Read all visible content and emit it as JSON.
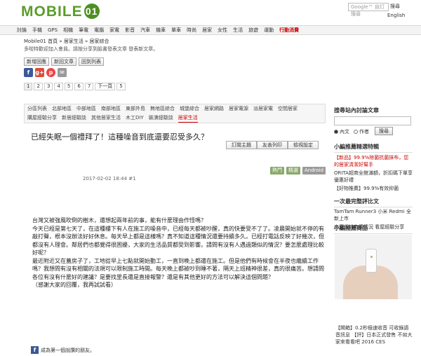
{
  "header": {
    "logo_text": "MOBILE",
    "logo_badge": "01",
    "search_placeholder": "Google™ 自訂搜尋",
    "search_button": "搜尋",
    "lang_link": "English"
  },
  "nav": {
    "items": [
      "討論",
      "手機",
      "GPS",
      "相機",
      "筆電",
      "電腦",
      "家電",
      "影音",
      "汽車",
      "機車",
      "單車",
      "時尚",
      "居家",
      "女性",
      "生活",
      "旅遊",
      "運動",
      "行動消費"
    ],
    "hot_index": 17
  },
  "breadcrumb": {
    "path": "Mobile01 首頁 » 居家生活 » 居家綜合"
  },
  "announcement": "多啦特歡迎加入會員。請按分享到臉書發表文章 發表新文章。",
  "buttons": {
    "new_topic": "新增回應",
    "new_reply": "新回文章",
    "back_list": "回到列表"
  },
  "social_icons": [
    "facebook-icon",
    "google-plus-icon",
    "plurk-icon",
    "mail-icon"
  ],
  "pager": {
    "pages": [
      "1",
      "2",
      "3",
      "4",
      "5",
      "6",
      "7"
    ],
    "current": "1",
    "next": "下一頁",
    "last": "5"
  },
  "forum_tabs": {
    "row1": [
      "分區列表",
      "北部地區",
      "中部地區",
      "南部地區",
      "東部外島",
      "無地區綜合",
      "城堡綜合",
      "居家網路",
      "居家電源",
      "派居家電",
      "空間居家"
    ],
    "row2": [
      "購屋經驗分享",
      "新居經驗談",
      "其他居家生活",
      "木工DIY",
      "裝潢經驗談",
      "居家生活"
    ],
    "selected": "居家生活"
  },
  "post": {
    "title": "已經失眠一個禮拜了！這種噪音到底還要忍受多久？",
    "actions": [
      "訂閱主題",
      "友善列印",
      "檢視設定"
    ],
    "tags": [
      "熱門",
      "精選",
      "Android"
    ],
    "meta": "2017-02-02 18:44  #1",
    "paragraphs": [
      "台灣又被強風吹倒的樹木，還想起兩年前的事，能有什麼理由作怪嗎？",
      "今天已經是第七天了，在這種樓下有人在施工的噪音中，已經每天都被吵醒，真的快要受不了了。凌晨開始就不停的有敲打聲，根本沒辦法好好休息。每天早上都是這樣嗎？真不知道這種情況還要持續多久。已經打電話反映了好幾次，但都沒有人理會。鄰居們也都覺得很困擾，大家的生活品質都受到影響。請問有沒有人遇過類似的情況？要怎麼處理比較好呢？",
      "最近附近又在蓋房子了，工地從早上七點就開始動工，一直到晚上都還在施工。但是他們有時候會在半夜也繼續工作嗎？我想問有沒有相關的法規可以限制施工時間。每天晚上都被吵到睡不著，隔天上班精神很差，真的很痛苦。想請問各位有沒有什麼好的建議？是要找里長還是直接報警？還是有其他更好的方法可以解決這個問題？",
      "（感謝大家的回覆，我再試試看）"
    ]
  },
  "fb_like": {
    "text": "成為第一個說讚的朋友。"
  },
  "sidebar": {
    "search_title": "搜尋站內討論文章",
    "radio_options": [
      "內文",
      "作者"
    ],
    "search_button": "搜尋",
    "hot_title": "小編推薦精選特輯",
    "hot_items": [
      "【新品】99.9%除菌抗菌抹布，您的居家清潔好幫手",
      "ORITA超商全館滿額，折扣碼下單享優惠好禮",
      "【好物推薦】99.9%有效抑菌"
    ],
    "featured_title": "一次最完整評比文",
    "featured_items": [
      "TamTam Runner3 小米 Redmi 全新上市",
      "房價低於市價情況 看屋經驗分享"
    ],
    "ad_title": "小編推薦商品",
    "ad_caption": "【開箱】0.2秒極速收音 可收錄語音訊息 【評】日本正式發售 不如大家來看看吧 2016 CES"
  }
}
